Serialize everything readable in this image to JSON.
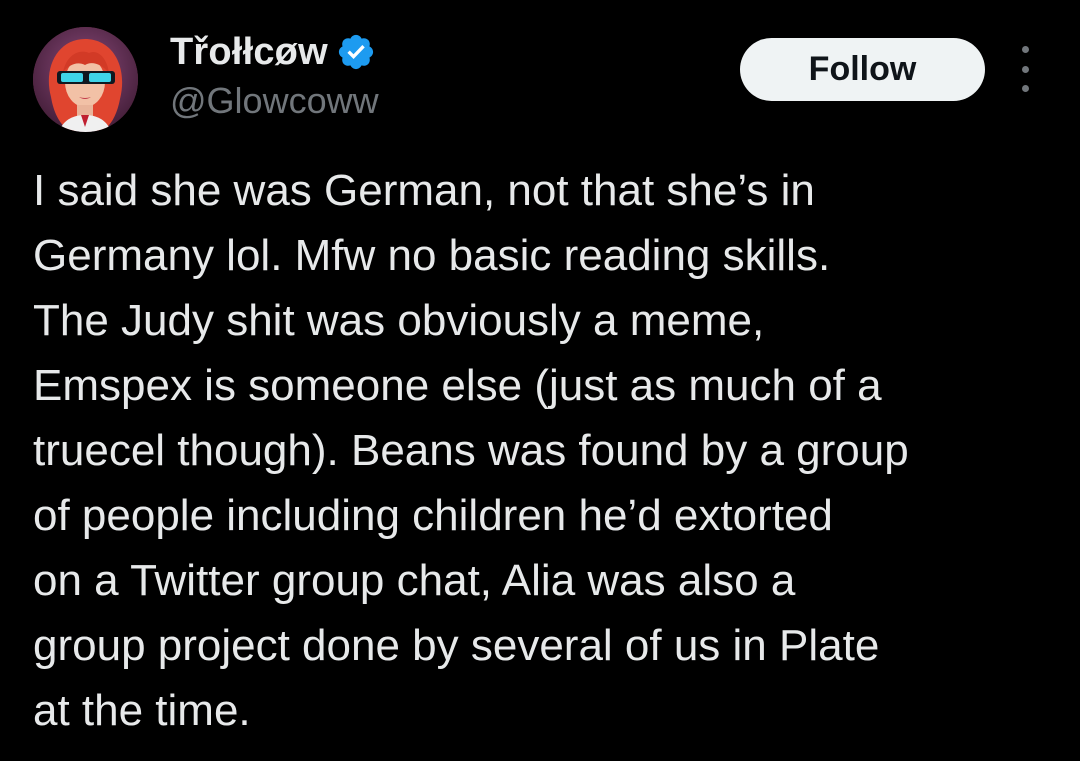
{
  "author": {
    "display_name": "Třołłcøw",
    "handle": "@Glowcoww",
    "verified": true,
    "verified_icon": "verified-badge-icon",
    "avatar_icon": "avatar-image"
  },
  "actions": {
    "follow_label": "Follow",
    "more_icon": "more-options-icon"
  },
  "tweet": {
    "lines": [
      "I said she was German, not that she’s in",
      "Germany lol. Mfw no basic reading skills.",
      "The Judy shit was obviously a meme,",
      "Emspex is someone else (just as much of a",
      "truecel though). Beans was found by a group",
      "of people including children he’d extorted",
      "on a Twitter group chat, Alia was also a",
      "group project done by several of us in Plate",
      "at the time."
    ]
  },
  "colors": {
    "background": "#000000",
    "text_primary": "#e7e9ea",
    "text_secondary": "#71767b",
    "verified_blue": "#1d9bf0",
    "follow_bg": "#eff3f4",
    "follow_text": "#0f1419"
  }
}
